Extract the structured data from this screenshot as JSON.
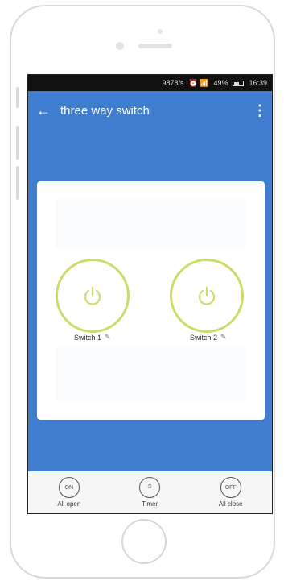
{
  "status_bar": {
    "network_speed": "9878/s",
    "icons": "⏰ 📶",
    "battery_percent": "49%",
    "time": "16:39"
  },
  "app_bar": {
    "title": "three way switch",
    "back_icon": "←",
    "menu_icon": "⋮"
  },
  "switches": [
    {
      "label": "Switch 1",
      "edit_icon": "✎"
    },
    {
      "label": "Switch 2",
      "edit_icon": "✎"
    }
  ],
  "actions": [
    {
      "icon_text": "ON",
      "label": "All open"
    },
    {
      "icon_text": "⏱",
      "label": "Timer"
    },
    {
      "icon_text": "OFF",
      "label": "All close"
    }
  ],
  "colors": {
    "accent_blue": "#3f7ecf",
    "switch_ring": "#c8dd6a"
  }
}
